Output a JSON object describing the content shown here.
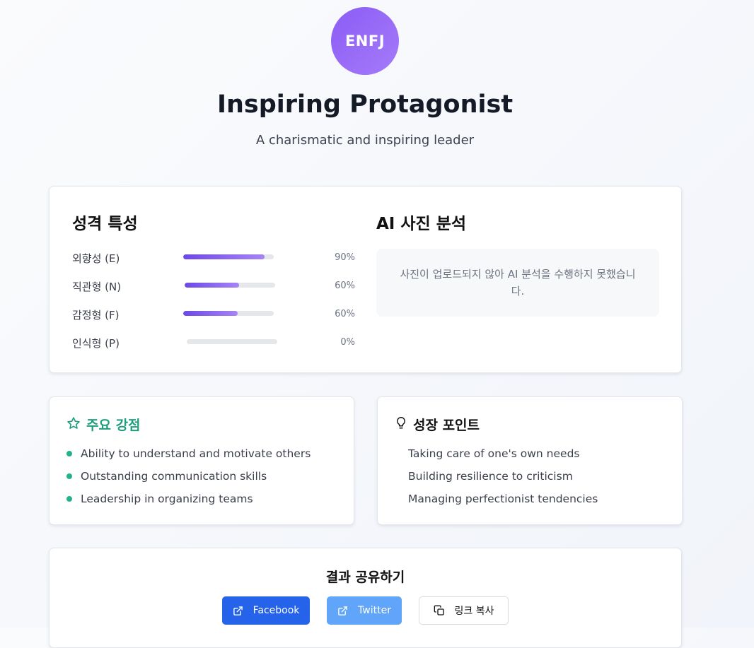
{
  "profile": {
    "type_code": "ENFJ",
    "title": "Inspiring Protagonist",
    "subtitle": "A charismatic and inspiring leader"
  },
  "traits": {
    "title": "성격 특성",
    "items": [
      {
        "label": "외향성 (E)",
        "value": 90,
        "value_text": "90%"
      },
      {
        "label": "직관형 (N)",
        "value": 60,
        "value_text": "60%"
      },
      {
        "label": "감정형 (F)",
        "value": 60,
        "value_text": "60%"
      },
      {
        "label": "인식형 (P)",
        "value": 0,
        "value_text": "0%"
      }
    ]
  },
  "ai_analysis": {
    "title": "AI 사진 분석",
    "message": "사진이 업로드되지 않아 AI 분석을 수행하지 못했습니다."
  },
  "strengths": {
    "title": "주요 강점",
    "icon": "star-icon",
    "items": [
      "Ability to understand and motivate others",
      "Outstanding communication skills",
      "Leadership in organizing teams"
    ]
  },
  "growth": {
    "title": "성장 포인트",
    "icon": "lightbulb-icon",
    "items": [
      "Taking care of one's own needs",
      "Building resilience to criticism",
      "Managing perfectionist tendencies"
    ]
  },
  "share": {
    "title": "결과 공유하기",
    "facebook_label": "Facebook",
    "twitter_label": "Twitter",
    "copy_label": "링크 복사"
  },
  "colors": {
    "accent_purple": "#8b5cf6",
    "strength_green": "#22b38a",
    "facebook_blue": "#2563eb",
    "twitter_blue": "#60a5fa"
  }
}
